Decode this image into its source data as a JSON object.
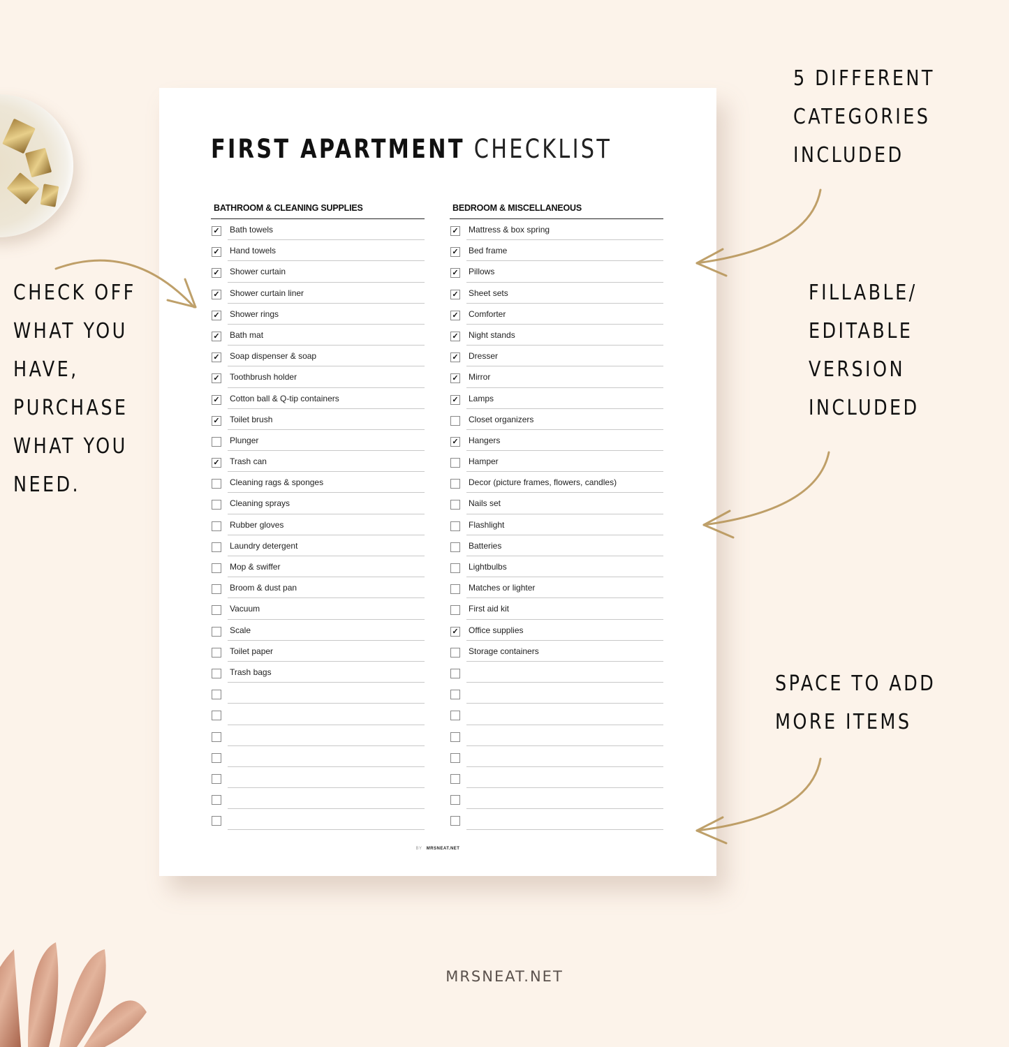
{
  "document": {
    "title_bold": "FIRST APARTMENT",
    "title_light": "CHECKLIST",
    "footer_by": "BY",
    "footer_brand": "MRSNEAT.NET"
  },
  "columns": [
    {
      "header": "BATHROOM & CLEANING SUPPLIES",
      "items": [
        {
          "label": "Bath towels",
          "checked": true
        },
        {
          "label": "Hand towels",
          "checked": true
        },
        {
          "label": "Shower curtain",
          "checked": true
        },
        {
          "label": "Shower curtain liner",
          "checked": true
        },
        {
          "label": "Shower rings",
          "checked": true
        },
        {
          "label": "Bath mat",
          "checked": true
        },
        {
          "label": "Soap dispenser & soap",
          "checked": true
        },
        {
          "label": "Toothbrush holder",
          "checked": true
        },
        {
          "label": "Cotton ball & Q-tip containers",
          "checked": true
        },
        {
          "label": "Toilet brush",
          "checked": true
        },
        {
          "label": "Plunger",
          "checked": false
        },
        {
          "label": "Trash can",
          "checked": true
        },
        {
          "label": "Cleaning rags & sponges",
          "checked": false
        },
        {
          "label": "Cleaning sprays",
          "checked": false
        },
        {
          "label": "Rubber gloves",
          "checked": false
        },
        {
          "label": "Laundry detergent",
          "checked": false
        },
        {
          "label": "Mop & swiffer",
          "checked": false
        },
        {
          "label": "Broom & dust pan",
          "checked": false
        },
        {
          "label": "Vacuum",
          "checked": false
        },
        {
          "label": "Scale",
          "checked": false
        },
        {
          "label": "Toilet paper",
          "checked": false
        },
        {
          "label": "Trash bags",
          "checked": false
        },
        {
          "label": "",
          "checked": false
        },
        {
          "label": "",
          "checked": false
        },
        {
          "label": "",
          "checked": false
        },
        {
          "label": "",
          "checked": false
        },
        {
          "label": "",
          "checked": false
        },
        {
          "label": "",
          "checked": false
        },
        {
          "label": "",
          "checked": false
        }
      ]
    },
    {
      "header": "BEDROOM & MISCELLANEOUS",
      "items": [
        {
          "label": "Mattress & box spring",
          "checked": true
        },
        {
          "label": "Bed frame",
          "checked": true
        },
        {
          "label": "Pillows",
          "checked": true
        },
        {
          "label": "Sheet sets",
          "checked": true
        },
        {
          "label": "Comforter",
          "checked": true
        },
        {
          "label": "Night stands",
          "checked": true
        },
        {
          "label": "Dresser",
          "checked": true
        },
        {
          "label": "Mirror",
          "checked": true
        },
        {
          "label": "Lamps",
          "checked": true
        },
        {
          "label": "Closet organizers",
          "checked": false
        },
        {
          "label": "Hangers",
          "checked": true
        },
        {
          "label": "Hamper",
          "checked": false
        },
        {
          "label": "Decor (picture frames, flowers, candles)",
          "checked": false
        },
        {
          "label": "Nails set",
          "checked": false
        },
        {
          "label": "Flashlight",
          "checked": false
        },
        {
          "label": "Batteries",
          "checked": false
        },
        {
          "label": "Lightbulbs",
          "checked": false
        },
        {
          "label": "Matches or lighter",
          "checked": false
        },
        {
          "label": "First aid kit",
          "checked": false
        },
        {
          "label": "Office supplies",
          "checked": true
        },
        {
          "label": "Storage containers",
          "checked": false
        },
        {
          "label": "",
          "checked": false
        },
        {
          "label": "",
          "checked": false
        },
        {
          "label": "",
          "checked": false
        },
        {
          "label": "",
          "checked": false
        },
        {
          "label": "",
          "checked": false
        },
        {
          "label": "",
          "checked": false
        },
        {
          "label": "",
          "checked": false
        },
        {
          "label": "",
          "checked": false
        }
      ]
    }
  ],
  "callouts": {
    "left": [
      "CHECK OFF",
      "WHAT YOU",
      "HAVE,",
      "PURCHASE",
      "WHAT YOU",
      "NEED."
    ],
    "right_top": [
      "5 DIFFERENT",
      "CATEGORIES",
      "INCLUDED"
    ],
    "right_middle": [
      "FILLABLE/",
      "EDITABLE",
      "VERSION",
      "INCLUDED"
    ],
    "right_bottom": [
      "SPACE TO ADD",
      "MORE ITEMS"
    ]
  },
  "site_label": "MRSNEAT.NET",
  "icons": {
    "checkmark": "✓",
    "arrow": "gold-curved-arrow-icon",
    "decor_top": "binder-clips-bowl",
    "decor_bottom": "monstera-leaf"
  },
  "colors": {
    "background": "#fcf3ea",
    "page": "#ffffff",
    "arrow_gold": "#b8965a",
    "text": "#111111"
  }
}
